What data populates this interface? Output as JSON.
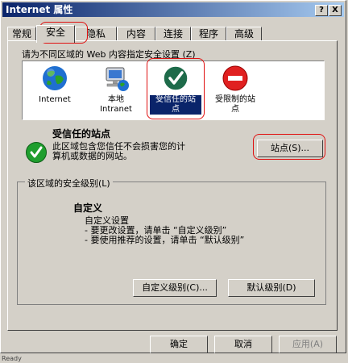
{
  "window": {
    "title": "Internet 属性",
    "help_btn": "?",
    "close_btn": "X"
  },
  "tabs": [
    {
      "label": "常规"
    },
    {
      "label": "安全"
    },
    {
      "label": "隐私"
    },
    {
      "label": "内容"
    },
    {
      "label": "连接"
    },
    {
      "label": "程序"
    },
    {
      "label": "高级"
    }
  ],
  "security": {
    "zone_prompt": "请为不同区域的 Web 内容指定安全设置 (Z)",
    "zones": [
      {
        "label": "Internet",
        "icon": "globe-icon"
      },
      {
        "label": "本地\nIntranet",
        "icon": "intranet-icon"
      },
      {
        "label": "受信任的站\n点",
        "icon": "trusted-check-icon",
        "selected": true
      },
      {
        "label": "受限制的站\n点",
        "icon": "restricted-icon"
      }
    ],
    "selected_zone": {
      "title": "受信任的站点",
      "description_line1": "此区域包含您信任不会损害您的计",
      "description_line2": "算机或数据的网站。",
      "sites_button": "站点(S)..."
    },
    "level_group": {
      "title": "该区域的安全级别(L)",
      "level_name": "自定义",
      "line1": "自定义设置",
      "line2": "- 要更改设置，请单击 “自定义级别”",
      "line3": "- 要使用推荐的设置，请单击 “默认级别”",
      "custom_button": "自定义级别(C)...",
      "default_button": "默认级别(D)"
    }
  },
  "footer": {
    "ok": "确定",
    "cancel": "取消",
    "apply": "应用(A)"
  },
  "status_text": "Ready"
}
